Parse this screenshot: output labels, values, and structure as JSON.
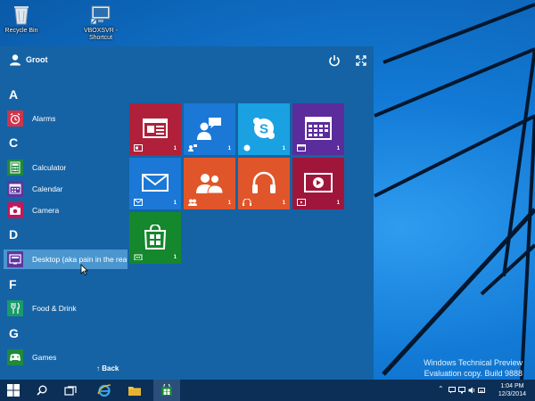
{
  "desktop": {
    "icons": [
      {
        "label": "Recycle Bin"
      },
      {
        "label": "VBOXSVR -",
        "label2": "Shortcut"
      }
    ],
    "watermark": {
      "line1": "Windows Technical Preview",
      "line2": "Evaluation copy. Build 9888"
    }
  },
  "start": {
    "user_name": "Groot",
    "letters": [
      "A",
      "C",
      "D",
      "F",
      "G"
    ],
    "apps": [
      {
        "label": "Alarms",
        "icon": "alarm-icon",
        "color": "#d1344a"
      },
      {
        "label": "Calculator",
        "icon": "calculator-icon",
        "color": "#1f8a3c"
      },
      {
        "label": "Calendar",
        "icon": "calendar-icon",
        "color": "#5d36a0"
      },
      {
        "label": "Camera",
        "icon": "camera-icon",
        "color": "#c2185b"
      },
      {
        "label": "Desktop (aka pain in the rea",
        "icon": "desktop-icon",
        "color": "#5d36a0"
      },
      {
        "label": "Food & Drink",
        "icon": "food-drink-icon",
        "color": "#1a9a6a"
      },
      {
        "label": "Games",
        "icon": "games-icon",
        "color": "#1f8a3c"
      }
    ],
    "back_label": "Back",
    "tiles": [
      {
        "icon": "news-icon",
        "badge": "1",
        "color": "#b0203a"
      },
      {
        "icon": "people-chat-icon",
        "badge": "1",
        "color": "#1b78d6"
      },
      {
        "icon": "skype-icon",
        "badge": "1",
        "color": "#1aa1e1"
      },
      {
        "icon": "calendar-tile-icon",
        "badge": "1",
        "color": "#5b2c9c"
      },
      {
        "icon": "mail-icon",
        "badge": "1",
        "color": "#1b78d6"
      },
      {
        "icon": "people-icon",
        "badge": "1",
        "color": "#e0562a"
      },
      {
        "icon": "music-icon",
        "badge": "1",
        "color": "#e0562a"
      },
      {
        "icon": "video-icon",
        "badge": "1",
        "color": "#a0163a"
      },
      {
        "icon": "store-icon",
        "badge": "1",
        "color": "#15872d"
      }
    ]
  },
  "taskbar": {
    "time": "1:04 PM",
    "date": "12/3/2014"
  }
}
